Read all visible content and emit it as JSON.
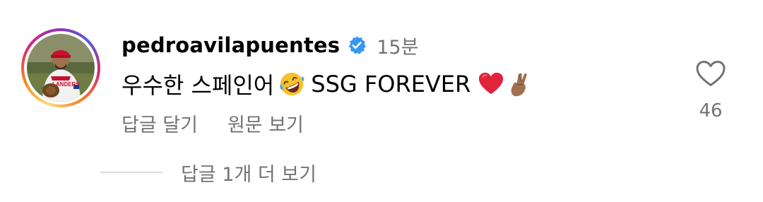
{
  "comment": {
    "username": "pedroavilapuentes",
    "verified": true,
    "time": "15분",
    "text_main": "우수한 스페인어",
    "text_end": "SSG FOREVER",
    "emojis": [
      "rolling-on-floor-laughing",
      "red-heart",
      "crossed-fingers-medium-dark-skin"
    ],
    "like_count": "46",
    "actions": {
      "reply": "답글 달기",
      "see_original": "원문 보기"
    },
    "view_replies": "답글 1개 더 보기"
  },
  "colors": {
    "text_primary": "#000000",
    "text_secondary": "#737373",
    "verified_blue": "#3897f0",
    "divider": "#dbdbdb"
  }
}
